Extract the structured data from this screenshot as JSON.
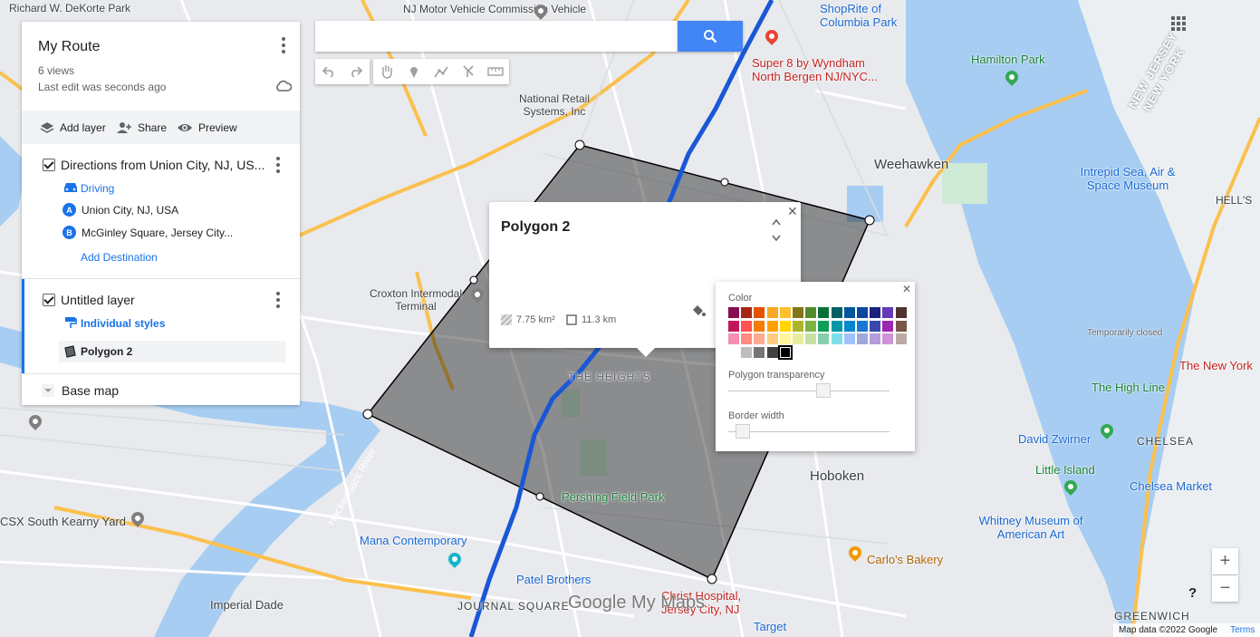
{
  "panel": {
    "title": "My Route",
    "views": "6 views",
    "last_edit": "Last edit was seconds ago",
    "toolbar": {
      "add_layer": "Add layer",
      "share": "Share",
      "preview": "Preview"
    },
    "layers": [
      {
        "title": "Directions from Union City, NJ, US...",
        "mode": "Driving",
        "waypoints": [
          {
            "badge": "A",
            "label": "Union City, NJ, USA"
          },
          {
            "badge": "B",
            "label": "McGinley Square, Jersey City..."
          }
        ],
        "add_destination": "Add Destination"
      },
      {
        "title": "Untitled layer",
        "style": "Individual styles",
        "feature": "Polygon 2"
      }
    ],
    "base_map": "Base map"
  },
  "search": {
    "value": "",
    "placeholder": ""
  },
  "info_window": {
    "title": "Polygon 2",
    "area": "7.75 km²",
    "perimeter": "11.3 km"
  },
  "style_popup": {
    "color_label": "Color",
    "transparency_label": "Polygon transparency",
    "border_label": "Border width",
    "transparency_value": 0.6,
    "border_value": 0.05,
    "selected_color": "#000000",
    "palette": [
      [
        "#880e4f",
        "#a52714",
        "#e65100",
        "#f9a825",
        "#fbc02d",
        "#817717",
        "#558b2f",
        "#097138",
        "#006064",
        "#01579b",
        "#0d47a1",
        "#1a237e",
        "#673ab7",
        "#4e342e"
      ],
      [
        "#c2185b",
        "#ff5252",
        "#f57c00",
        "#ffa000",
        "#ffd600",
        "#afb42b",
        "#7cb342",
        "#0f9d58",
        "#0097a7",
        "#0288d1",
        "#1976d2",
        "#3949ab",
        "#9c27b0",
        "#795548"
      ],
      [
        "#f48fb1",
        "#ff8a80",
        "#ffab91",
        "#ffcc80",
        "#fff59d",
        "#e6ee9c",
        "#c5e1a5",
        "#87ceac",
        "#80deea",
        "#a1c2fa",
        "#9fa8da",
        "#b39ddb",
        "#ce93d8",
        "#bcaaa4"
      ],
      [
        "#ffffff",
        "#bdbdbd",
        "#757575",
        "#424242",
        "#000000"
      ]
    ]
  },
  "map": {
    "labels": [
      {
        "text": "Richard W. DeKorte Park",
        "cls": ""
      },
      {
        "text": "NJ Motor Vehicle Commission Vehicle",
        "cls": ""
      },
      {
        "text": "ShopRite of Columbia Park",
        "cls": "poi-blue"
      },
      {
        "text": "Super 8 by Wyndham North Bergen NJ/NYC...",
        "cls": "poi-red"
      },
      {
        "text": "Hamilton Park",
        "cls": "poi-green"
      },
      {
        "text": "National Retail Systems, Inc",
        "cls": ""
      },
      {
        "text": "Weehawken",
        "cls": "big"
      },
      {
        "text": "Intrepid Sea, Air & Space Museum",
        "cls": "poi-blue"
      },
      {
        "text": "HELL'S",
        "cls": ""
      },
      {
        "text": "Croxton Intermodal Terminal",
        "cls": ""
      },
      {
        "text": "THE HEIGHTS",
        "cls": "street"
      },
      {
        "text": "Temporarily closed",
        "cls": "street"
      },
      {
        "text": "The New York",
        "cls": "poi-red"
      },
      {
        "text": "The High Line",
        "cls": "poi-green"
      },
      {
        "text": "David Zwirner",
        "cls": "poi-blue"
      },
      {
        "text": "CHELSEA",
        "cls": ""
      },
      {
        "text": "Hoboken",
        "cls": "big"
      },
      {
        "text": "Little Island",
        "cls": "poi-green"
      },
      {
        "text": "Chelsea Market",
        "cls": "poi-blue"
      },
      {
        "text": "Pershing Field Park",
        "cls": "poi-green"
      },
      {
        "text": "CSX South Kearny Yard",
        "cls": ""
      },
      {
        "text": "Mana Contemporary",
        "cls": "poi-blue"
      },
      {
        "text": "Whitney Museum of American Art",
        "cls": "poi-blue"
      },
      {
        "text": "Carlo's Bakery",
        "cls": "poi-orange"
      },
      {
        "text": "Patel Brothers",
        "cls": "poi-blue"
      },
      {
        "text": "Imperial Dade",
        "cls": ""
      },
      {
        "text": "JOURNAL SQUARE",
        "cls": ""
      },
      {
        "text": "Christ Hospital, Jersey City, NJ",
        "cls": "poi-red"
      },
      {
        "text": "Target",
        "cls": "poi-blue"
      },
      {
        "text": "GREENWICH",
        "cls": ""
      },
      {
        "text": "Hackensack River",
        "cls": "water"
      },
      {
        "text": "NEW JERSEY",
        "cls": "state"
      },
      {
        "text": "NEW YORK",
        "cls": "state"
      }
    ],
    "watermark": "Google My Maps",
    "attribution": "Map data ©2022 Google",
    "terms": "Terms"
  },
  "colors": {
    "accent": "#1a73e8",
    "search_button": "#4285f4",
    "route": "#1a57d6",
    "polygon_fill": "#000000",
    "water": "#a7cdf2",
    "land": "#e8eaed"
  }
}
